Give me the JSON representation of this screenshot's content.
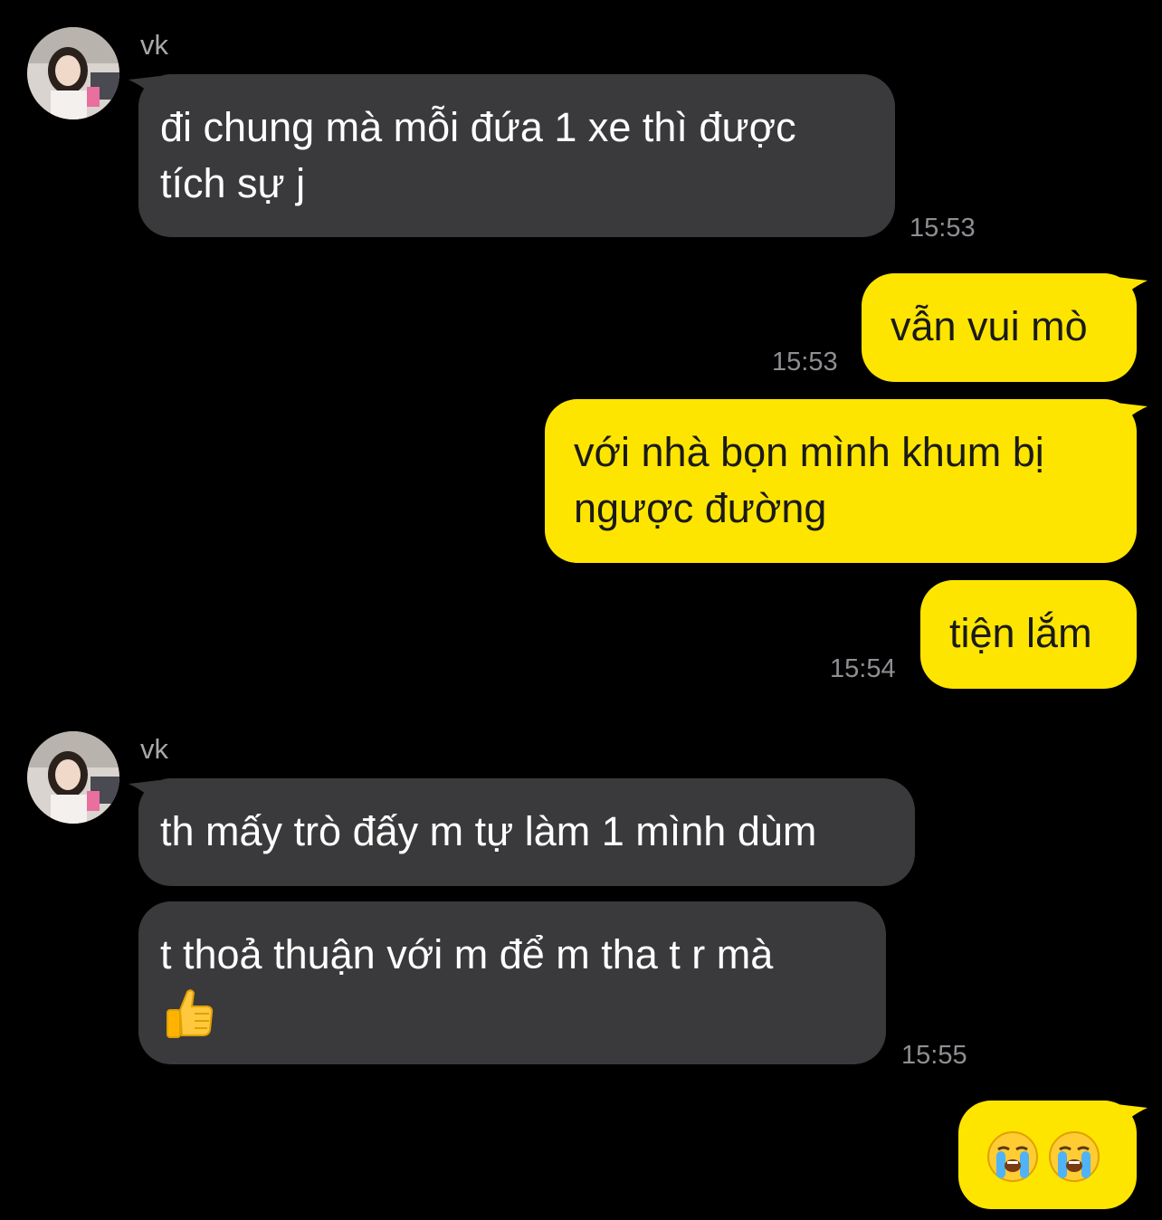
{
  "chat": {
    "group1": {
      "sender": "vk",
      "avatar_icon": "profile-photo",
      "msg1": {
        "line1": "đi chung mà mỗi đứa 1 xe thì được",
        "line2": "tích sự j",
        "time": "15:53"
      }
    },
    "out1": {
      "text": "vẫn vui mò",
      "time": "15:53"
    },
    "out2": {
      "line1": "với nhà bọn mình khum bị",
      "line2": "ngược đường"
    },
    "out3": {
      "text": "tiện lắm",
      "time": "15:54"
    },
    "group2": {
      "sender": "vk",
      "avatar_icon": "profile-photo",
      "msg1": {
        "text": "th mấy trò đấy m tự làm 1 mình dùm"
      },
      "msg2": {
        "line1": "t thoả thuận với m để m tha t r mà",
        "emoji_icon": "thumbs-up-emoji",
        "time": "15:55"
      }
    },
    "out4": {
      "emoji_icons": [
        "loudly-crying-face-emoji",
        "loudly-crying-face-emoji"
      ]
    }
  },
  "colors": {
    "background": "#000000",
    "incoming_bubble": "#3a3a3c",
    "outgoing_bubble": "#fee500",
    "timestamp": "#8e8e93",
    "sender_name": "#a8a8a8"
  }
}
